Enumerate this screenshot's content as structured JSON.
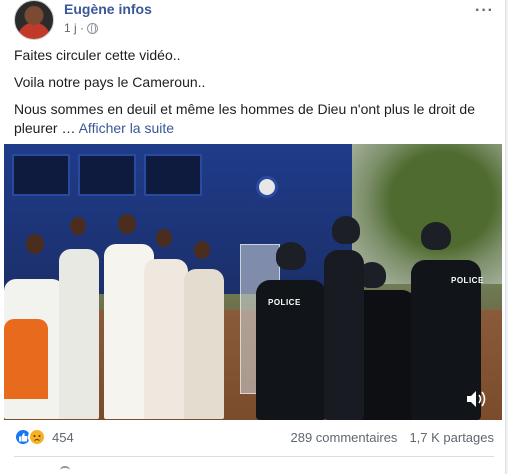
{
  "post": {
    "author": "Eugène infos",
    "time": "1 j ·",
    "audience_icon": "globe-icon",
    "more_icon": "more-options-icon",
    "more_glyph": "···",
    "lines": [
      "Faites circuler cette vidéo..",
      "Voila notre pays le Cameroun..",
      "Nous sommes en deuil et même les hommes de Dieu n'ont plus le droit de pleurer …"
    ],
    "see_more": "Afficher la suite"
  },
  "video": {
    "badge_text": "POLICE",
    "volume_icon": "speaker-icon"
  },
  "footer": {
    "reaction_count": "454",
    "comments": "289 commentaires",
    "shares": "1,7 K partages"
  },
  "colors": {
    "link": "#385898",
    "like": "#1877f2",
    "sad": "#f7b125"
  }
}
